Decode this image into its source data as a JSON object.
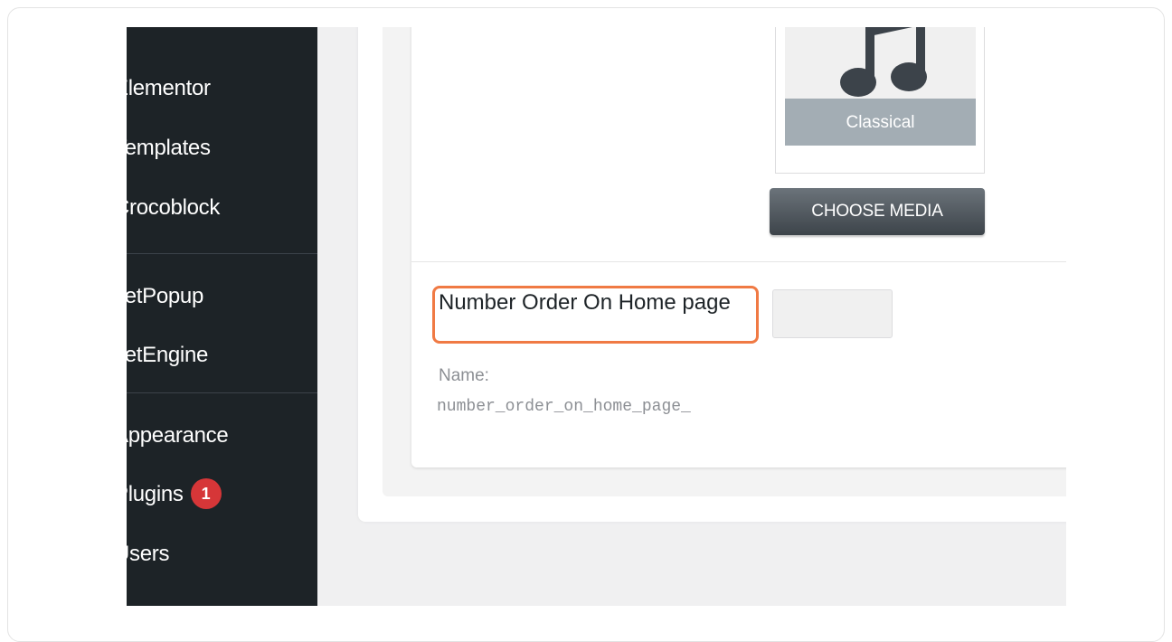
{
  "sidebar": {
    "items": [
      {
        "label": "Elementor"
      },
      {
        "label": "Templates"
      },
      {
        "label": "Crocoblock"
      },
      {
        "label": "JetPopup"
      },
      {
        "label": "JetEngine"
      },
      {
        "label": "Appearance"
      },
      {
        "label": "Plugins",
        "badge": "1"
      },
      {
        "label": "Users"
      }
    ]
  },
  "media": {
    "thumbnail_caption": "Classical",
    "icon": "music-note-icon",
    "choose_button": "CHOOSE MEDIA"
  },
  "field": {
    "label": "Number Order On Home page",
    "value": "",
    "name_label": "Name:",
    "name_value": "number_order_on_home_page_"
  },
  "colors": {
    "sidebar_bg": "#1d2327",
    "highlight": "#f07a44",
    "badge": "#d63638",
    "button": "#4a5157"
  }
}
